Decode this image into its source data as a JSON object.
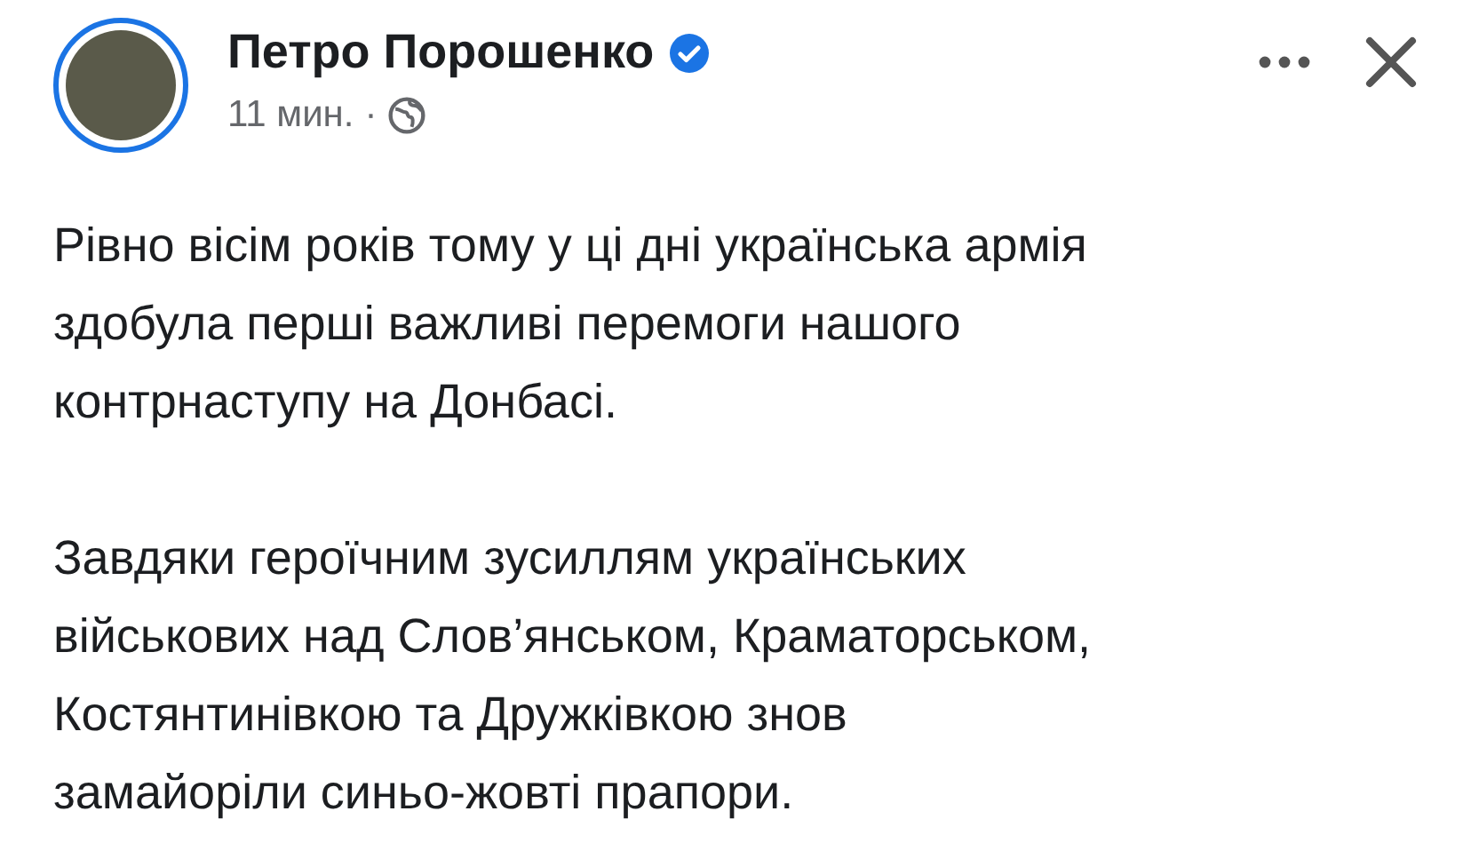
{
  "post": {
    "author": "Петро Порошенко",
    "verified": true,
    "time": "11 мин.",
    "separator": "·",
    "paragraphs": [
      [
        "Рівно вісім років тому у ці дні українська армія",
        "здобула перші важливі перемоги нашого",
        "контрнаступу на Донбасі."
      ],
      [
        "Завдяки героїчним зусиллям українських",
        "військових над Слов’янськом, Краматорськом,",
        "Костянтинівкою та Дружківкою знов",
        "замайоріли синьо-жовті прапори."
      ]
    ]
  }
}
